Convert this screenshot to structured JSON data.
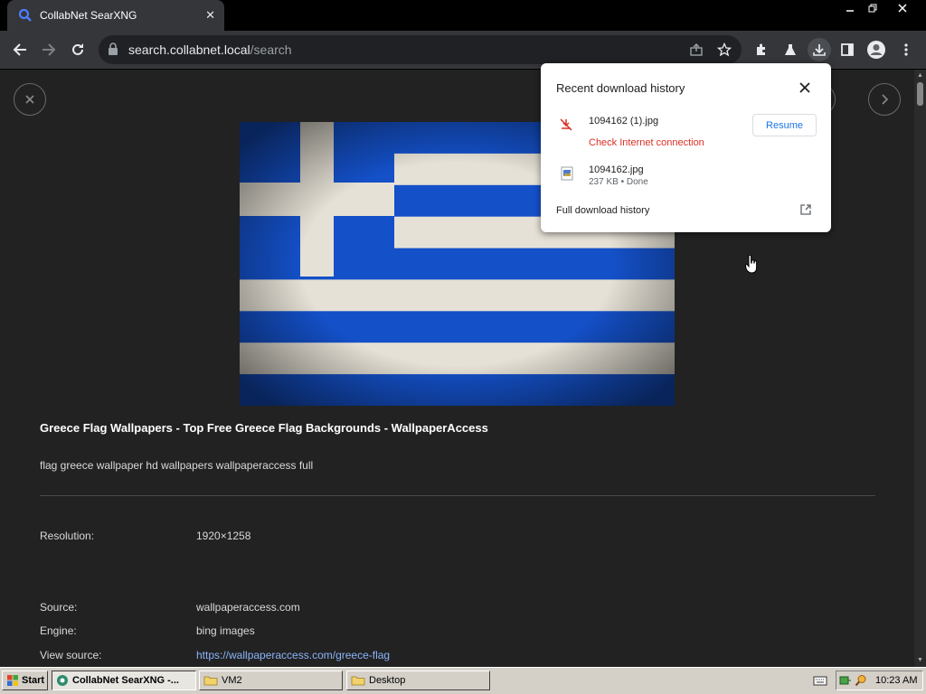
{
  "browser": {
    "tab_title": "CollabNet SearXNG",
    "url_host": "search.collabnet.local",
    "url_path": "/search"
  },
  "result": {
    "title": "Greece Flag Wallpapers - Top Free Greece Flag Backgrounds - WallpaperAccess",
    "description": "flag greece wallpaper hd wallpapers wallpaperaccess full",
    "details": [
      {
        "label": "Resolution:",
        "value": "1920×1258"
      },
      {
        "label": "Source:",
        "value": "wallpaperaccess.com"
      },
      {
        "label": "Engine:",
        "value": "bing images"
      },
      {
        "label": "View source:",
        "value": "https://wallpaperaccess.com/greece-flag"
      }
    ]
  },
  "downloads": {
    "title": "Recent download history",
    "items": [
      {
        "name": "1094162 (1).jpg",
        "status": "Check Internet connection",
        "action": "Resume"
      },
      {
        "name": "1094162.jpg",
        "status": "237 KB • Done"
      }
    ],
    "full_history": "Full download history"
  },
  "taskbar": {
    "start": "Start",
    "buttons": [
      "CollabNet SearXNG -...",
      "VM2",
      "Desktop"
    ],
    "clock": "10:23 AM"
  },
  "colors": {
    "accent_link": "#8ab4f8",
    "error_red": "#d93025",
    "flag_blue": "#1450c8"
  }
}
